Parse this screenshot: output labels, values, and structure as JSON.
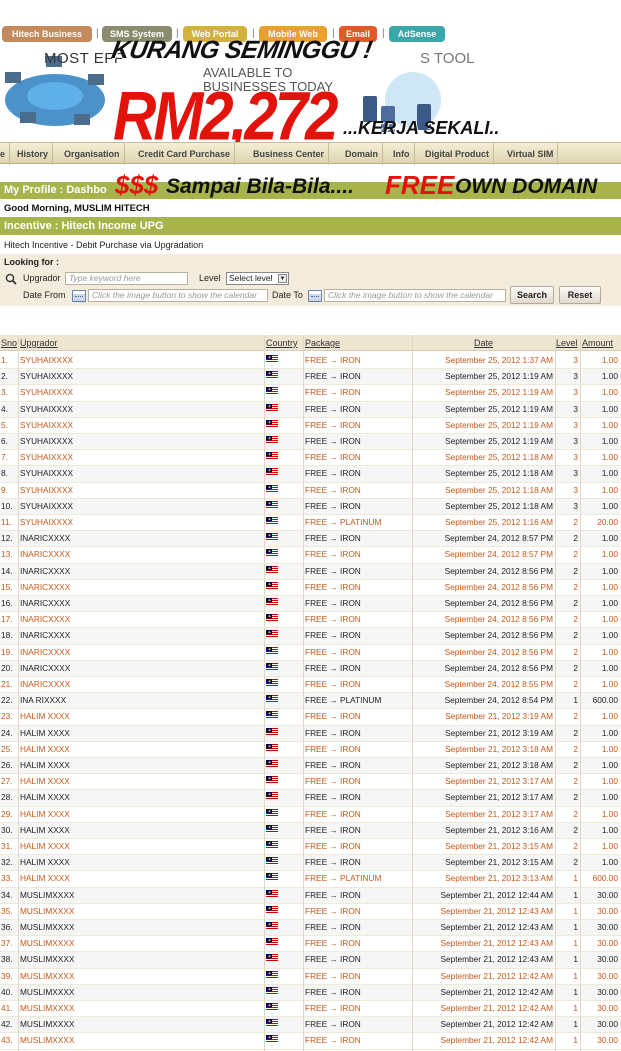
{
  "top_tabs": [
    {
      "label": "Hitech Business",
      "color": "#c38a5c"
    },
    {
      "label": "SMS System",
      "color": "#8b8b6d"
    },
    {
      "label": "Web Portal",
      "color": "#d1b23c"
    },
    {
      "label": "Mobile Web",
      "color": "#e8a12c"
    },
    {
      "label": "Email",
      "color": "#e05a27"
    },
    {
      "label": "AdSense",
      "color": "#3aa7a8"
    }
  ],
  "banner": {
    "slogan_left": "MOST EFF",
    "slogan_right": "S TOOL",
    "slogan_mid1": "AVAILABLE TO",
    "slogan_mid2": "BUSINESSES TODAY"
  },
  "promo": {
    "headline": "KURANG SEMINGGU !",
    "amount": "RM2,272",
    "kerja": "...KERJA SEKALI..",
    "dollar": "$$$",
    "sampai": "Sampai Bila-Bila....",
    "free": "FREE",
    "own_domain": "OWN DOMAIN"
  },
  "nav": [
    "e",
    "History",
    "Organisation",
    "Credit Card Purchase",
    "Business Center",
    "Domain",
    "Info",
    "Digital Product",
    "Virtual SIM"
  ],
  "profile": {
    "title": "My Profile : Dashbo",
    "greeting": "Good Morning, MUSLIM HITECH"
  },
  "incentive": {
    "title": "Incentive : Hitech Income UPG",
    "subtitle": "Hitech Incentive - Debit Purchase via Upgradation",
    "looking_for": "Looking for :",
    "upgrador_label": "Upgrador",
    "upgrador_placeholder": "Type keyword here",
    "level_label": "Level",
    "level_value": "Select level",
    "date_from_label": "Date From",
    "date_to_label": "Date To",
    "date_placeholder": "Click the image button to show the calendar",
    "search_button": "Search",
    "reset_button": "Reset"
  },
  "table": {
    "headers": {
      "sno": "Sno",
      "upgrador": "Upgrador",
      "country": "Country",
      "package": "Package",
      "date": "Date",
      "level": "Level",
      "amount": "Amount"
    },
    "rows": [
      {
        "sno": "1.",
        "upgrador": "SYUHAIXXXX",
        "package": "FREE → IRON",
        "date": "September 25, 2012 1:37 AM",
        "level": "3",
        "amount": "1.00"
      },
      {
        "sno": "2.",
        "upgrador": "SYUHAIXXXX",
        "package": "FREE → IRON",
        "date": "September 25, 2012 1:19 AM",
        "level": "3",
        "amount": "1.00"
      },
      {
        "sno": "3.",
        "upgrador": "SYUHAIXXXX",
        "package": "FREE → IRON",
        "date": "September 25, 2012 1:19 AM",
        "level": "3",
        "amount": "1.00"
      },
      {
        "sno": "4.",
        "upgrador": "SYUHAIXXXX",
        "package": "FREE → IRON",
        "date": "September 25, 2012 1:19 AM",
        "level": "3",
        "amount": "1.00"
      },
      {
        "sno": "5.",
        "upgrador": "SYUHAIXXXX",
        "package": "FREE → IRON",
        "date": "September 25, 2012 1:19 AM",
        "level": "3",
        "amount": "1.00"
      },
      {
        "sno": "6.",
        "upgrador": "SYUHAIXXXX",
        "package": "FREE → IRON",
        "date": "September 25, 2012 1:19 AM",
        "level": "3",
        "amount": "1.00"
      },
      {
        "sno": "7.",
        "upgrador": "SYUHAIXXXX",
        "package": "FREE → IRON",
        "date": "September 25, 2012 1:18 AM",
        "level": "3",
        "amount": "1.00"
      },
      {
        "sno": "8.",
        "upgrador": "SYUHAIXXXX",
        "package": "FREE → IRON",
        "date": "September 25, 2012 1:18 AM",
        "level": "3",
        "amount": "1.00"
      },
      {
        "sno": "9.",
        "upgrador": "SYUHAIXXXX",
        "package": "FREE → IRON",
        "date": "September 25, 2012 1:18 AM",
        "level": "3",
        "amount": "1.00"
      },
      {
        "sno": "10.",
        "upgrador": "SYUHAIXXXX",
        "package": "FREE → IRON",
        "date": "September 25, 2012 1:18 AM",
        "level": "3",
        "amount": "1.00"
      },
      {
        "sno": "11.",
        "upgrador": "SYUHAIXXXX",
        "package": "FREE → PLATINUM",
        "date": "September 25, 2012 1:16 AM",
        "level": "2",
        "amount": "20.00"
      },
      {
        "sno": "12.",
        "upgrador": "INARICXXXX",
        "package": "FREE → IRON",
        "date": "September 24, 2012 8:57 PM",
        "level": "2",
        "amount": "1.00"
      },
      {
        "sno": "13.",
        "upgrador": "INARICXXXX",
        "package": "FREE → IRON",
        "date": "September 24, 2012 8:57 PM",
        "level": "2",
        "amount": "1.00"
      },
      {
        "sno": "14.",
        "upgrador": "INARICXXXX",
        "package": "FREE → IRON",
        "date": "September 24, 2012 8:56 PM",
        "level": "2",
        "amount": "1.00"
      },
      {
        "sno": "15.",
        "upgrador": "INARICXXXX",
        "package": "FREE → IRON",
        "date": "September 24, 2012 8:56 PM",
        "level": "2",
        "amount": "1.00"
      },
      {
        "sno": "16.",
        "upgrador": "INARICXXXX",
        "package": "FREE → IRON",
        "date": "September 24, 2012 8:56 PM",
        "level": "2",
        "amount": "1.00"
      },
      {
        "sno": "17.",
        "upgrador": "INARICXXXX",
        "package": "FREE → IRON",
        "date": "September 24, 2012 8:56 PM",
        "level": "2",
        "amount": "1.00"
      },
      {
        "sno": "18.",
        "upgrador": "INARICXXXX",
        "package": "FREE → IRON",
        "date": "September 24, 2012 8:56 PM",
        "level": "2",
        "amount": "1.00"
      },
      {
        "sno": "19.",
        "upgrador": "INARICXXXX",
        "package": "FREE → IRON",
        "date": "September 24, 2012 8:56 PM",
        "level": "2",
        "amount": "1.00"
      },
      {
        "sno": "20.",
        "upgrador": "INARICXXXX",
        "package": "FREE → IRON",
        "date": "September 24, 2012 8:56 PM",
        "level": "2",
        "amount": "1.00"
      },
      {
        "sno": "21.",
        "upgrador": "INARICXXXX",
        "package": "FREE → IRON",
        "date": "September 24, 2012 8:55 PM",
        "level": "2",
        "amount": "1.00"
      },
      {
        "sno": "22.",
        "upgrador": "INA RIXXXX",
        "package": "FREE → PLATINUM",
        "date": "September 24, 2012 8:54 PM",
        "level": "1",
        "amount": "600.00"
      },
      {
        "sno": "23.",
        "upgrador": "HALIM XXXX",
        "package": "FREE → IRON",
        "date": "September 21, 2012 3:19 AM",
        "level": "2",
        "amount": "1.00"
      },
      {
        "sno": "24.",
        "upgrador": "HALIM XXXX",
        "package": "FREE → IRON",
        "date": "September 21, 2012 3:19 AM",
        "level": "2",
        "amount": "1.00"
      },
      {
        "sno": "25.",
        "upgrador": "HALIM XXXX",
        "package": "FREE → IRON",
        "date": "September 21, 2012 3:18 AM",
        "level": "2",
        "amount": "1.00"
      },
      {
        "sno": "26.",
        "upgrador": "HALIM XXXX",
        "package": "FREE → IRON",
        "date": "September 21, 2012 3:18 AM",
        "level": "2",
        "amount": "1.00"
      },
      {
        "sno": "27.",
        "upgrador": "HALIM XXXX",
        "package": "FREE → IRON",
        "date": "September 21, 2012 3:17 AM",
        "level": "2",
        "amount": "1.00"
      },
      {
        "sno": "28.",
        "upgrador": "HALIM XXXX",
        "package": "FREE → IRON",
        "date": "September 21, 2012 3:17 AM",
        "level": "2",
        "amount": "1.00"
      },
      {
        "sno": "29.",
        "upgrador": "HALIM XXXX",
        "package": "FREE → IRON",
        "date": "September 21, 2012 3:17 AM",
        "level": "2",
        "amount": "1.00"
      },
      {
        "sno": "30.",
        "upgrador": "HALIM XXXX",
        "package": "FREE → IRON",
        "date": "September 21, 2012 3:16 AM",
        "level": "2",
        "amount": "1.00"
      },
      {
        "sno": "31.",
        "upgrador": "HALIM XXXX",
        "package": "FREE → IRON",
        "date": "September 21, 2012 3:15 AM",
        "level": "2",
        "amount": "1.00"
      },
      {
        "sno": "32.",
        "upgrador": "HALIM XXXX",
        "package": "FREE → IRON",
        "date": "September 21, 2012 3:15 AM",
        "level": "2",
        "amount": "1.00"
      },
      {
        "sno": "33.",
        "upgrador": "HALIM XXXX",
        "package": "FREE → PLATINUM",
        "date": "September 21, 2012 3:13 AM",
        "level": "1",
        "amount": "600.00"
      },
      {
        "sno": "34.",
        "upgrador": "MUSLIMXXXX",
        "package": "FREE → IRON",
        "date": "September 21, 2012 12:44 AM",
        "level": "1",
        "amount": "30.00"
      },
      {
        "sno": "35.",
        "upgrador": "MUSLIMXXXX",
        "package": "FREE → IRON",
        "date": "September 21, 2012 12:43 AM",
        "level": "1",
        "amount": "30.00"
      },
      {
        "sno": "36.",
        "upgrador": "MUSLIMXXXX",
        "package": "FREE → IRON",
        "date": "September 21, 2012 12:43 AM",
        "level": "1",
        "amount": "30.00"
      },
      {
        "sno": "37.",
        "upgrador": "MUSLIMXXXX",
        "package": "FREE → IRON",
        "date": "September 21, 2012 12:43 AM",
        "level": "1",
        "amount": "30.00"
      },
      {
        "sno": "38.",
        "upgrador": "MUSLIMXXXX",
        "package": "FREE → IRON",
        "date": "September 21, 2012 12:43 AM",
        "level": "1",
        "amount": "30.00"
      },
      {
        "sno": "39.",
        "upgrador": "MUSLIMXXXX",
        "package": "FREE → IRON",
        "date": "September 21, 2012 12:42 AM",
        "level": "1",
        "amount": "30.00"
      },
      {
        "sno": "40.",
        "upgrador": "MUSLIMXXXX",
        "package": "FREE → IRON",
        "date": "September 21, 2012 12:42 AM",
        "level": "1",
        "amount": "30.00"
      },
      {
        "sno": "41.",
        "upgrador": "MUSLIMXXXX",
        "package": "FREE → IRON",
        "date": "September 21, 2012 12:42 AM",
        "level": "1",
        "amount": "30.00"
      },
      {
        "sno": "42.",
        "upgrador": "MUSLIMXXXX",
        "package": "FREE → IRON",
        "date": "September 21, 2012 12:42 AM",
        "level": "1",
        "amount": "30.00"
      },
      {
        "sno": "43.",
        "upgrador": "MUSLIMXXXX",
        "package": "FREE → IRON",
        "date": "September 21, 2012 12:42 AM",
        "level": "1",
        "amount": "30.00"
      }
    ]
  }
}
